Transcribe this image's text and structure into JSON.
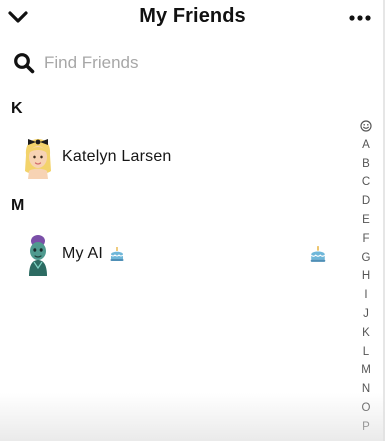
{
  "header": {
    "title": "My Friends",
    "back_icon": "chevron-down-icon",
    "more_icon": "more-horizontal-icon"
  },
  "search": {
    "placeholder": "Find Friends",
    "value": "",
    "icon": "search-icon"
  },
  "sections": [
    {
      "letter": "K",
      "friends": [
        {
          "name": "Katelyn Larsen",
          "avatar": "bitmoji-avatar-blonde"
        }
      ]
    },
    {
      "letter": "M",
      "friends": [
        {
          "name": "My AI",
          "avatar": "my-ai-avatar",
          "name_emoji": "birthday-cake-icon",
          "badge": "birthday-cake-icon"
        }
      ]
    }
  ],
  "alphabet_index": {
    "top_icon": "smiley-icon",
    "letters": [
      "A",
      "B",
      "C",
      "D",
      "E",
      "F",
      "G",
      "H",
      "I",
      "J",
      "K",
      "L",
      "M",
      "N",
      "O",
      "P"
    ]
  },
  "colors": {
    "text": "#111111",
    "placeholder": "#a7a7a7",
    "index_text": "#555555"
  }
}
